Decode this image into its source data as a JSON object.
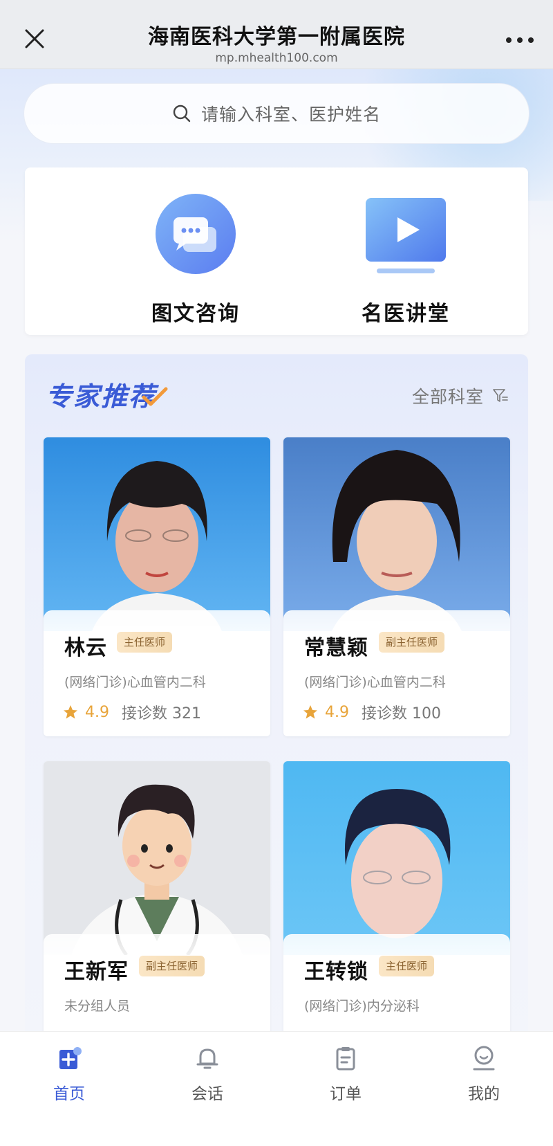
{
  "window": {
    "title": "海南医科大学第一附属医院",
    "url": "mp.mhealth100.com"
  },
  "search": {
    "placeholder": "请输入科室、医护姓名"
  },
  "services": [
    {
      "label": "图文咨询",
      "icon": "chat-bubble-icon"
    },
    {
      "label": "名医讲堂",
      "icon": "video-play-icon"
    }
  ],
  "experts": {
    "title": "专家推荐",
    "all_departments": "全部科室",
    "cards": [
      {
        "name": "林云",
        "title": "主任医师",
        "department": "(网络门诊)心血管内二科",
        "rating": "4.9",
        "visits": "接诊数 321"
      },
      {
        "name": "常慧颖",
        "title": "副主任医师",
        "department": "(网络门诊)心血管内二科",
        "rating": "4.9",
        "visits": "接诊数 100"
      },
      {
        "name": "王新军",
        "title": "副主任医师",
        "department": "未分组人员"
      },
      {
        "name": "王转锁",
        "title": "主任医师",
        "department": "(网络门诊)内分泌科"
      }
    ]
  },
  "bottom_nav": [
    {
      "label": "首页",
      "icon": "hospital-home-icon",
      "active": true
    },
    {
      "label": "会话",
      "icon": "bell-icon",
      "active": false
    },
    {
      "label": "订单",
      "icon": "clipboard-icon",
      "active": false
    },
    {
      "label": "我的",
      "icon": "user-icon",
      "active": false
    }
  ],
  "colors": {
    "accent": "#3a5bd6",
    "rating": "#e8a43a",
    "badge_bg": "#fbe6c6"
  }
}
